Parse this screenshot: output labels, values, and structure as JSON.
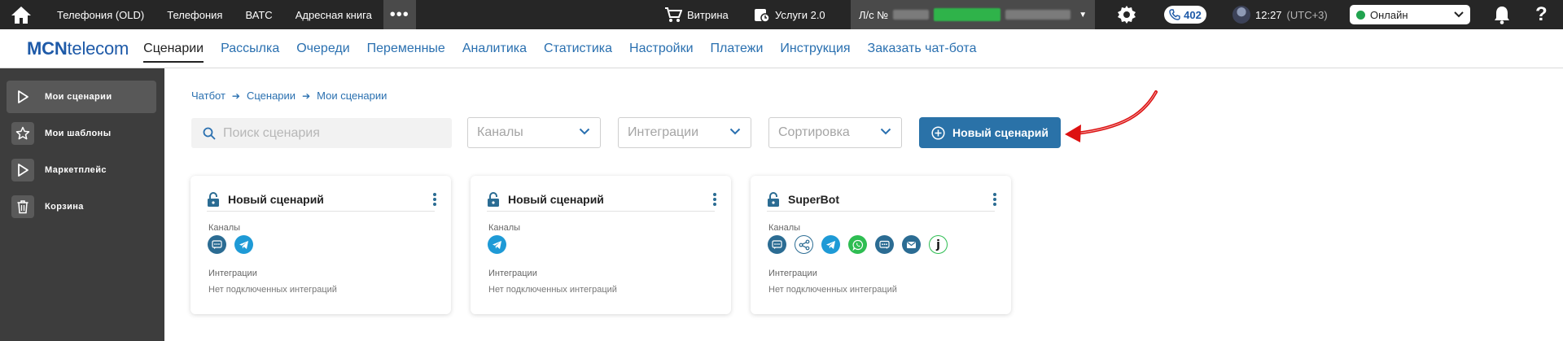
{
  "topbar": {
    "links": [
      "Телефония (OLD)",
      "Телефония",
      "ВАТС",
      "Адресная книга"
    ],
    "more_label": "•••",
    "shop_label": "Витрина",
    "services_label": "Услуги 2.0",
    "account_prefix": "Л/с №",
    "calls_count": "402",
    "time": "12:27",
    "timezone": "(UTC+3)",
    "status": "Онлайн",
    "help": "?"
  },
  "nav": {
    "logo_bold": "MCN",
    "logo_rest": "telecom",
    "links": [
      "Сценарии",
      "Рассылка",
      "Очереди",
      "Переменные",
      "Аналитика",
      "Статистика",
      "Настройки",
      "Платежи",
      "Инструкция",
      "Заказать чат-бота"
    ],
    "active_index": 0
  },
  "sidebar": {
    "items": [
      {
        "label": "Мои сценарии",
        "icon": "play-icon",
        "active": true
      },
      {
        "label": "Мои шаблоны",
        "icon": "star-icon",
        "active": false
      },
      {
        "label": "Маркетплейс",
        "icon": "play-icon",
        "active": false
      },
      {
        "label": "Корзина",
        "icon": "trash-icon",
        "active": false
      }
    ]
  },
  "breadcrumb": [
    "Чатбот",
    "Сценарии",
    "Мои сценарии"
  ],
  "search": {
    "placeholder": "Поиск сценария"
  },
  "filters": {
    "channels": "Каналы",
    "integrations": "Интеграции",
    "sort": "Сортировка"
  },
  "new_button": "Новый сценарий",
  "card_labels": {
    "channels": "Каналы",
    "integrations": "Интеграции",
    "no_integrations": "Нет подключенных интеграций"
  },
  "cards": [
    {
      "title": "Новый сценарий",
      "channels": [
        "sms",
        "tg"
      ]
    },
    {
      "title": "Новый сценарий",
      "channels": [
        "tg"
      ]
    },
    {
      "title": "SuperBot",
      "channels": [
        "sms",
        "share",
        "tg",
        "wa",
        "chat",
        "mail",
        "j"
      ]
    }
  ],
  "colors": {
    "topbar_bg": "#262626",
    "sidebar_bg": "#3d3d3d",
    "accent": "#2a72a8",
    "link": "#2a70b0",
    "online": "#21a34f"
  }
}
